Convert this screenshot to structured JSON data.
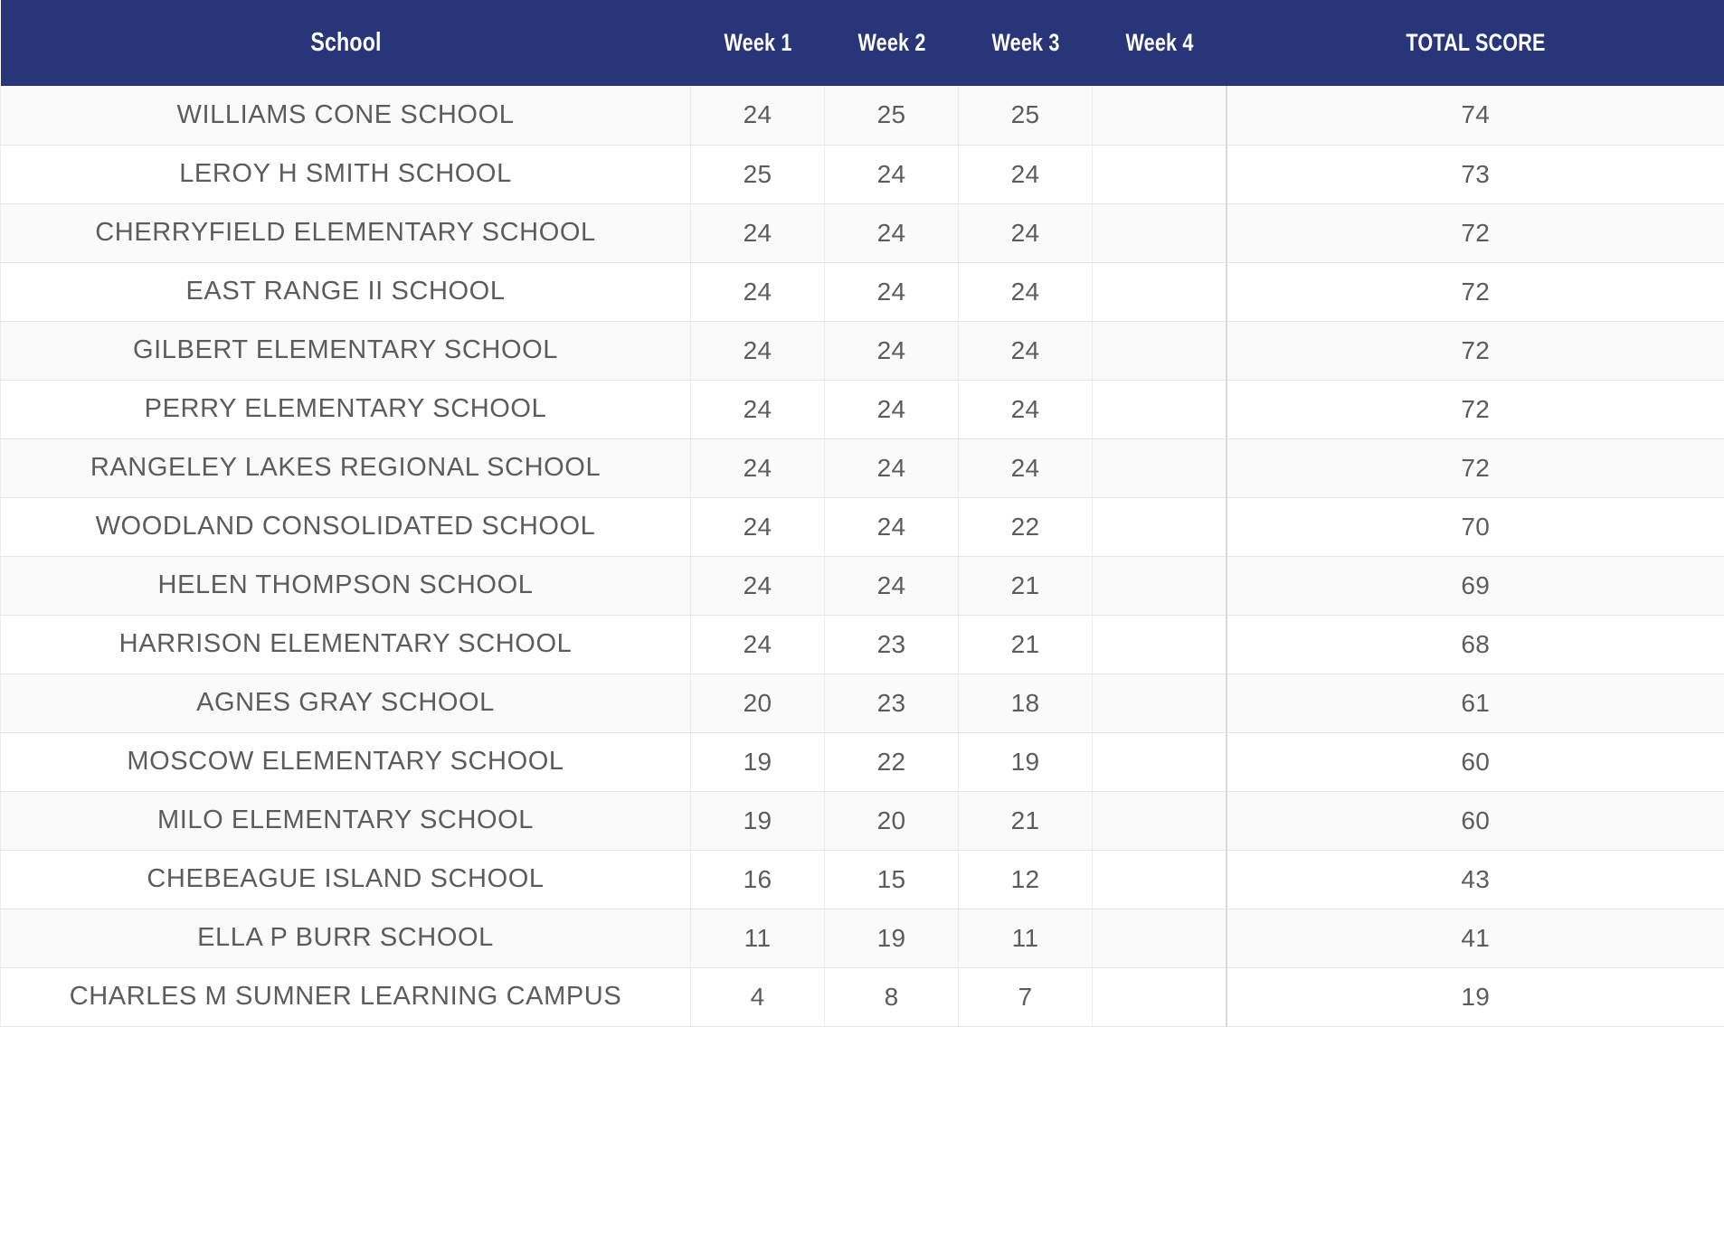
{
  "theme": {
    "header_bg": "#283578",
    "header_text": "#ffffff",
    "row_odd_bg": "#fafafa",
    "row_even_bg": "#ffffff",
    "cell_text": "#5c5c5c",
    "border": "#e6e6e6",
    "total_border": "#dadada"
  },
  "table": {
    "columns": [
      {
        "key": "school",
        "label": "School"
      },
      {
        "key": "week1",
        "label": "Week 1"
      },
      {
        "key": "week2",
        "label": "Week 2"
      },
      {
        "key": "week3",
        "label": "Week 3"
      },
      {
        "key": "week4",
        "label": "Week 4"
      },
      {
        "key": "total",
        "label": "TOTAL SCORE"
      }
    ],
    "rows": [
      {
        "school": "WILLIAMS CONE SCHOOL",
        "week1": "24",
        "week2": "25",
        "week3": "25",
        "week4": "",
        "total": "74"
      },
      {
        "school": "LEROY H SMITH SCHOOL",
        "week1": "25",
        "week2": "24",
        "week3": "24",
        "week4": "",
        "total": "73"
      },
      {
        "school": "CHERRYFIELD ELEMENTARY SCHOOL",
        "week1": "24",
        "week2": "24",
        "week3": "24",
        "week4": "",
        "total": "72"
      },
      {
        "school": "EAST RANGE II SCHOOL",
        "week1": "24",
        "week2": "24",
        "week3": "24",
        "week4": "",
        "total": "72"
      },
      {
        "school": "GILBERT ELEMENTARY SCHOOL",
        "week1": "24",
        "week2": "24",
        "week3": "24",
        "week4": "",
        "total": "72"
      },
      {
        "school": "PERRY ELEMENTARY SCHOOL",
        "week1": "24",
        "week2": "24",
        "week3": "24",
        "week4": "",
        "total": "72"
      },
      {
        "school": "RANGELEY LAKES REGIONAL SCHOOL",
        "week1": "24",
        "week2": "24",
        "week3": "24",
        "week4": "",
        "total": "72"
      },
      {
        "school": "WOODLAND CONSOLIDATED SCHOOL",
        "week1": "24",
        "week2": "24",
        "week3": "22",
        "week4": "",
        "total": "70"
      },
      {
        "school": "HELEN THOMPSON SCHOOL",
        "week1": "24",
        "week2": "24",
        "week3": "21",
        "week4": "",
        "total": "69"
      },
      {
        "school": "HARRISON ELEMENTARY SCHOOL",
        "week1": "24",
        "week2": "23",
        "week3": "21",
        "week4": "",
        "total": "68"
      },
      {
        "school": "AGNES GRAY SCHOOL",
        "week1": "20",
        "week2": "23",
        "week3": "18",
        "week4": "",
        "total": "61"
      },
      {
        "school": "MOSCOW ELEMENTARY SCHOOL",
        "week1": "19",
        "week2": "22",
        "week3": "19",
        "week4": "",
        "total": "60"
      },
      {
        "school": "MILO ELEMENTARY SCHOOL",
        "week1": "19",
        "week2": "20",
        "week3": "21",
        "week4": "",
        "total": "60"
      },
      {
        "school": "CHEBEAGUE ISLAND SCHOOL",
        "week1": "16",
        "week2": "15",
        "week3": "12",
        "week4": "",
        "total": "43"
      },
      {
        "school": "ELLA P BURR SCHOOL",
        "week1": "11",
        "week2": "19",
        "week3": "11",
        "week4": "",
        "total": "41"
      },
      {
        "school": "CHARLES M SUMNER LEARNING CAMPUS",
        "week1": "4",
        "week2": "8",
        "week3": "7",
        "week4": "",
        "total": "19"
      }
    ]
  }
}
